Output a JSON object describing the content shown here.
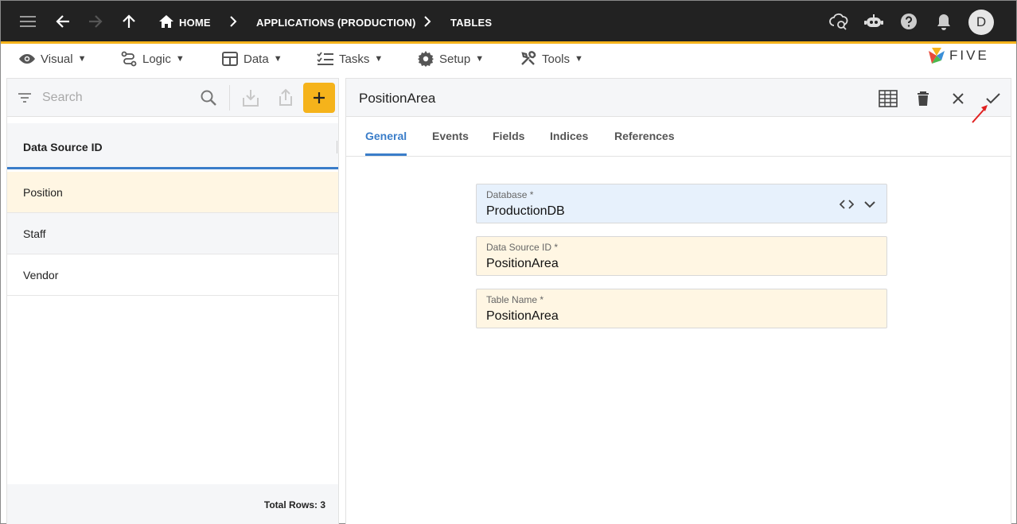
{
  "topbar": {
    "breadcrumbs": [
      "HOME",
      "APPLICATIONS (PRODUCTION)",
      "TABLES"
    ],
    "avatar_initial": "D"
  },
  "menu": {
    "items": [
      {
        "label": "Visual",
        "icon": "eye-icon"
      },
      {
        "label": "Logic",
        "icon": "logic-icon"
      },
      {
        "label": "Data",
        "icon": "table-icon"
      },
      {
        "label": "Tasks",
        "icon": "checklist-icon"
      },
      {
        "label": "Setup",
        "icon": "gear-icon"
      },
      {
        "label": "Tools",
        "icon": "tools-icon"
      }
    ],
    "caret": "▼",
    "logo_text": "FIVE"
  },
  "list": {
    "search_placeholder": "Search",
    "column_header": "Data Source ID",
    "rows": [
      "Position",
      "Staff",
      "Vendor"
    ],
    "total_rows": "Total Rows: 3"
  },
  "form": {
    "title": "PositionArea",
    "tabs": [
      "General",
      "Events",
      "Fields",
      "Indices",
      "References"
    ],
    "active_tab": "General",
    "fields": [
      {
        "label": "Database *",
        "value": "ProductionDB"
      },
      {
        "label": "Data Source ID *",
        "value": "PositionArea"
      },
      {
        "label": "Table Name *",
        "value": "PositionArea"
      }
    ]
  },
  "colors": {
    "topbar_bg": "#222222",
    "accent_yellow": "#f5b31b",
    "accent_blue": "#3a7dc9",
    "selected_row": "#fff6e3",
    "field_blue": "#e7f1fc"
  }
}
